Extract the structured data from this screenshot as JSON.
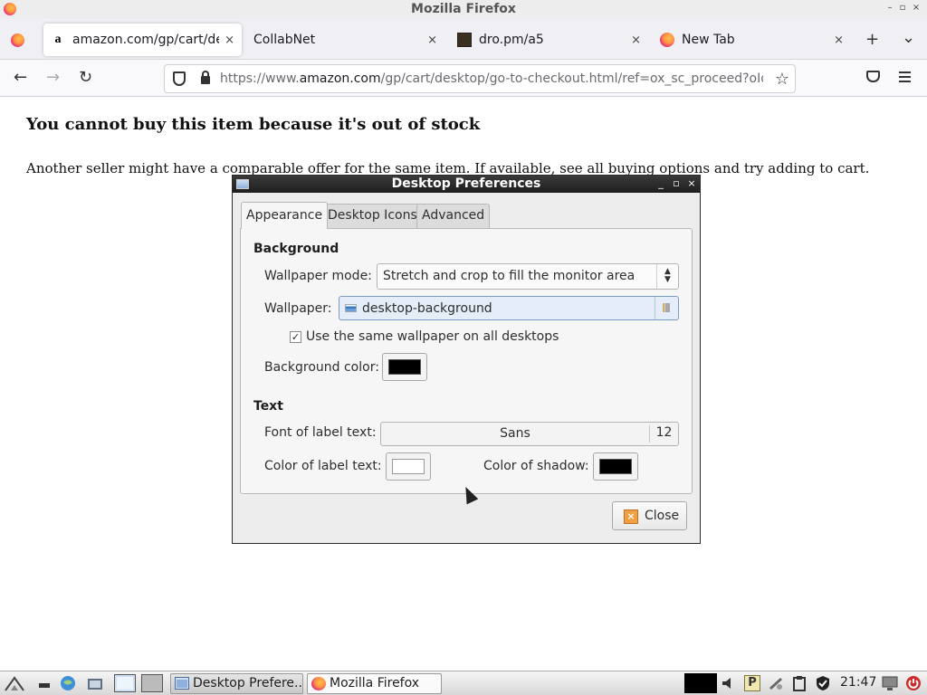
{
  "window": {
    "title": "Mozilla Firefox",
    "controls": [
      "–",
      "▫",
      "×"
    ]
  },
  "tabs": [
    {
      "label": "amazon.com/gp/cart/desktop/go-to-checkout.html",
      "icon": "amazon-favicon",
      "active": true
    },
    {
      "label": "CollabNet",
      "icon": "none",
      "active": false
    },
    {
      "label": "dro.pm/a5",
      "icon": "dro-favicon",
      "active": false
    },
    {
      "label": "New Tab",
      "icon": "firefox-favicon",
      "active": false
    }
  ],
  "tab_close_glyph": "×",
  "new_tab_glyph": "+",
  "tab_list_glyph": "⌄",
  "nav": {
    "back_glyph": "←",
    "forward_glyph": "→",
    "reload_glyph": "↻",
    "url_prefix": "https://www.",
    "url_host": "amazon.com",
    "url_path": "/gp/cart/desktop/go-to-checkout.html/ref=ox_sc_proceed?oId=",
    "star_glyph": "☆"
  },
  "page": {
    "heading": "You cannot buy this item because it's out of stock",
    "message": "Another seller might have a comparable offer for the same item. If available, see all buying options and try adding to cart."
  },
  "dialog": {
    "title": "Desktop Preferences",
    "controls": [
      "_",
      "▫",
      "×"
    ],
    "tabs": [
      "Appearance",
      "Desktop Icons",
      "Advanced"
    ],
    "active_tab": "Appearance",
    "background": {
      "section": "Background",
      "wallpaper_mode_label": "Wallpaper mode:",
      "wallpaper_mode_value": "Stretch and crop to fill the monitor area",
      "wallpaper_label": "Wallpaper:",
      "wallpaper_value": "desktop-background",
      "same_wallpaper_label": "Use the same wallpaper on all desktops",
      "same_wallpaper_checked": true,
      "check_glyph": "✓",
      "background_color_label": "Background color:",
      "background_color": "#000000"
    },
    "text": {
      "section": "Text",
      "font_label": "Font of label text:",
      "font_name": "Sans",
      "font_size": "12",
      "label_color_label": "Color of label text:",
      "label_color": "#ffffff",
      "shadow_color_label": "Color of shadow:",
      "shadow_color": "#000000"
    },
    "close_label": "Close",
    "close_glyph": "×"
  },
  "taskbar": {
    "tasks": [
      {
        "label": "Desktop Prefere...",
        "active": true
      },
      {
        "label": "Mozilla Firefox",
        "active": false
      }
    ],
    "clock": "21:47",
    "tray_p_glyph": "P"
  },
  "colors": {
    "dialog_title_bg": "#1e1e1e",
    "page_text": "#111111",
    "accent_selection": "#e5eef8"
  }
}
